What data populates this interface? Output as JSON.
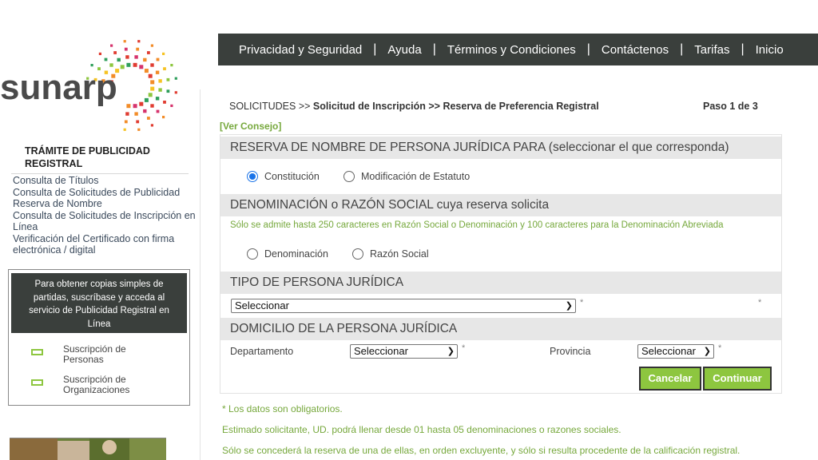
{
  "brand": {
    "logo_text": "sunarp",
    "accent": "#8dc63f",
    "nav_bg": "#3a3f3c"
  },
  "sidebar": {
    "title": "TRÁMITE DE PUBLICIDAD REGISTRAL",
    "links": [
      "Consulta de Títulos",
      "Consulta de Solicitudes de Publicidad",
      "Reserva de Nombre",
      "Consulta de Solicitudes de Inscripción en Línea",
      "Verificación del Certificado con firma electrónica / digital"
    ],
    "promo_text": "Para obtener copias simples de partidas, suscríbase y acceda al servicio de Publicidad Registral en Línea",
    "promo_items": [
      {
        "label": "Suscripción de Personas",
        "icon": "envelope-icon"
      },
      {
        "label": "Suscripción de Organizaciones",
        "icon": "envelope-icon"
      }
    ]
  },
  "nav": [
    "Privacidad y Seguridad",
    "Ayuda",
    "Términos y Condiciones",
    "Contáctenos",
    "Tarifas",
    "Inicio"
  ],
  "breadcrumb": {
    "part1": "SOLICITUDES >> ",
    "part2": "Solicitud de Inscripción >> Reserva de Preferencia Registral"
  },
  "step": "Paso 1 de 3",
  "ver_consejo": "[Ver Consejo]",
  "form": {
    "section1_title": "RESERVA DE NOMBRE DE PERSONA JURÍDICA PARA (seleccionar el que corresponda)",
    "section1_options": [
      {
        "label": "Constitución",
        "checked": true
      },
      {
        "label": "Modificación de Estatuto",
        "checked": false
      }
    ],
    "section2_title": "DENOMINACIÓN o RAZÓN SOCIAL cuya reserva solicita",
    "section2_hint": "Sólo se admite hasta 250 caracteres en Razón Social o Denominación y 100 caracteres para la Denominación Abreviada",
    "section2_options": [
      {
        "label": "Denominación",
        "checked": false
      },
      {
        "label": "Razón Social",
        "checked": false
      }
    ],
    "section3_title": "TIPO DE PERSONA JURÍDICA",
    "tipo_select": "Seleccionar",
    "required_mark": "*",
    "section4_title": "DOMICILIO DE LA PERSONA JURÍDICA",
    "departamento_label": "Departamento",
    "departamento_select": "Seleccionar",
    "provincia_label": "Provincia",
    "provincia_select": "Seleccionar",
    "cancel_label": "Cancelar",
    "continue_label": "Continuar"
  },
  "notes": [
    "* Los datos son obligatorios.",
    "Estimado solicitante, UD. podrá llenar desde 01 hasta 05 denominaciones o razones sociales.",
    "Sólo se concederá la reserva de una de ellas, en orden excluyente, y sólo si resulta procedente de la calificación registral."
  ]
}
